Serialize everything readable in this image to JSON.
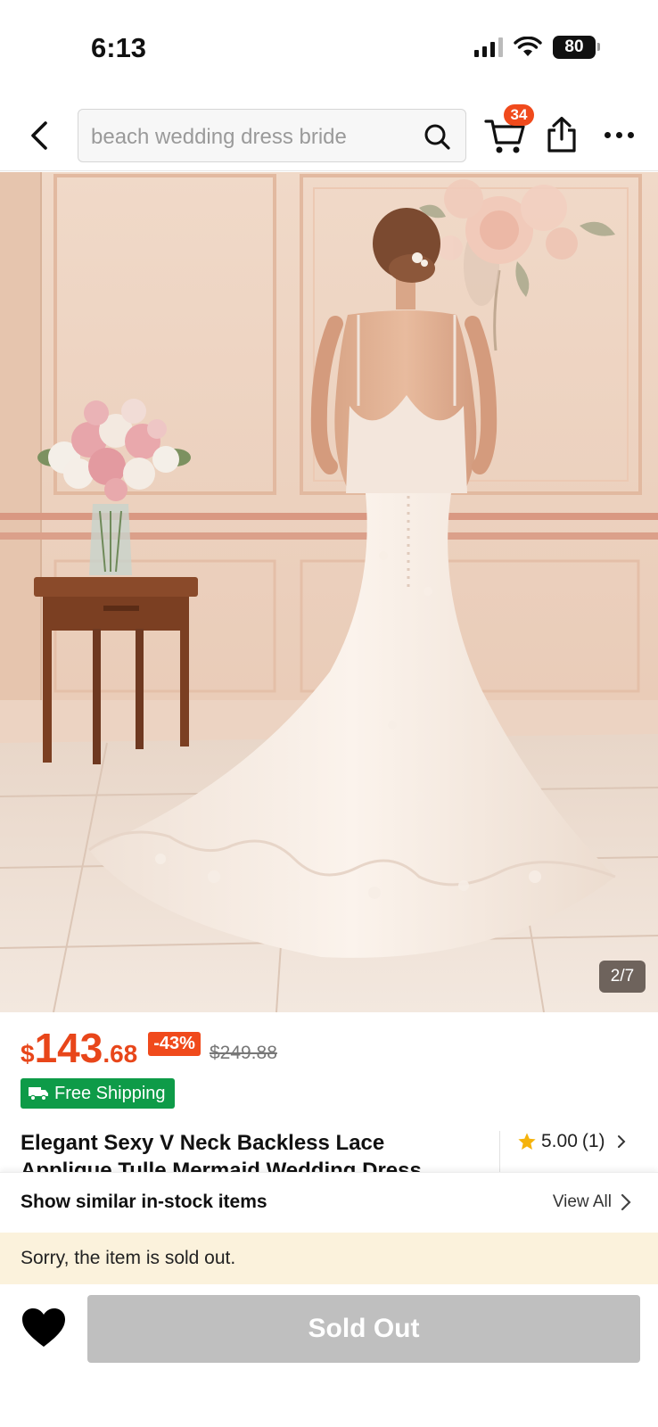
{
  "status_bar": {
    "time": "6:13",
    "battery": "80"
  },
  "header": {
    "search_placeholder": "beach wedding dress bride",
    "cart_count": "34"
  },
  "gallery": {
    "counter": "2/7"
  },
  "product": {
    "price_currency": "$",
    "price_integer": "143",
    "price_decimal": ".68",
    "discount": "-43%",
    "original_price": "$249.88",
    "shipping_badge": "Free Shipping",
    "title": "Elegant Sexy V Neck Backless Lace Applique Tulle Mermaid Wedding Dress",
    "rating": "5.00",
    "review_count": "(1)"
  },
  "similar": {
    "label": "Show similar in-stock items",
    "view_all": "View All"
  },
  "notice": {
    "text": "Sorry, the item is sold out."
  },
  "actions": {
    "sold_out_label": "Sold Out"
  },
  "colors": {
    "accent": "#f04a1c",
    "shipping_green": "#0e9b48",
    "disabled_button": "#bfbfbf",
    "notice_bg": "#fbf2dc"
  }
}
